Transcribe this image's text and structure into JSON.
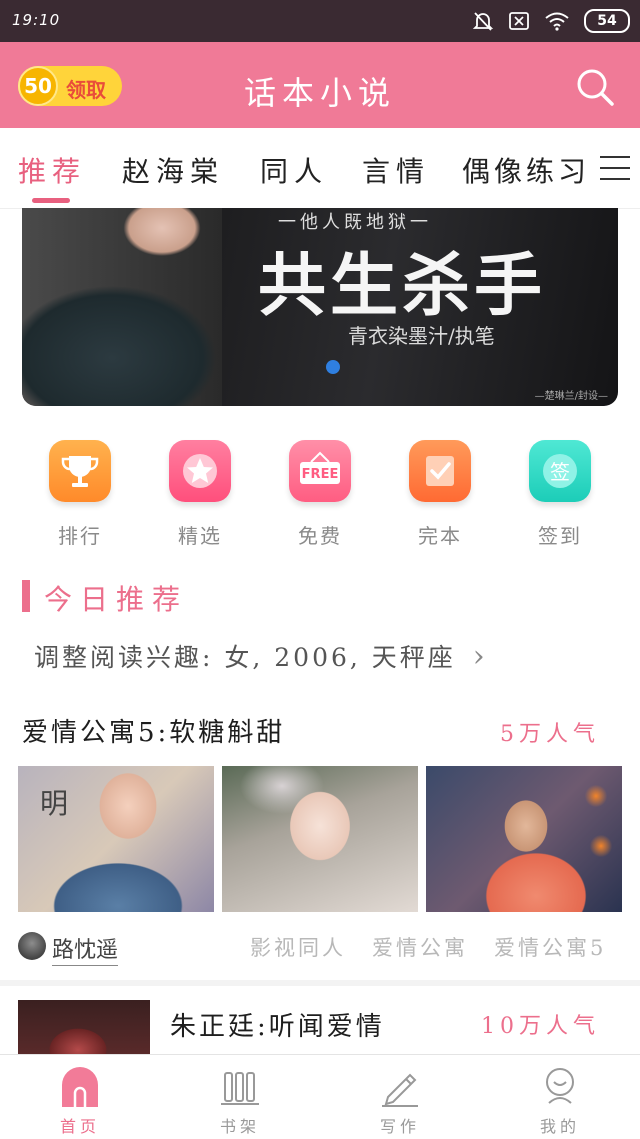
{
  "status_bar": {
    "time": "19:10",
    "battery": "54",
    "icons": [
      "mute-bell-icon",
      "close-box-icon",
      "wifi-icon",
      "battery-icon"
    ]
  },
  "header": {
    "coin_count": "50",
    "coin_label": "领取",
    "title": "话本小说",
    "search_icon": "search-icon",
    "bg_color": "#f07a97"
  },
  "tabs": [
    {
      "label": "推荐",
      "active": true
    },
    {
      "label": "赵海棠",
      "active": false
    },
    {
      "label": "同人",
      "active": false
    },
    {
      "label": "言情",
      "active": false
    },
    {
      "label": "偶像练习",
      "active": false
    }
  ],
  "banner": {
    "subtitle": "一他人既地狱一",
    "title": "共生杀手",
    "author": "青衣染墨汁/执笔",
    "credit": "—楚琳兰/封设—"
  },
  "quick_links": [
    {
      "label": "排行",
      "icon": "trophy-icon",
      "color": "#ff9a3c"
    },
    {
      "label": "精选",
      "icon": "star-icon",
      "color": "#ff5f8a"
    },
    {
      "label": "免费",
      "icon": "free-tag-icon",
      "color": "#ff6b8d"
    },
    {
      "label": "完本",
      "icon": "checkbox-icon",
      "color": "#ff7b45"
    },
    {
      "label": "签到",
      "icon": "sign-in-icon",
      "color": "#2ed9c4"
    }
  ],
  "today": {
    "title": "今日推荐",
    "interest_text": "调整阅读兴趣: 女, 2006, 天秤座",
    "chevron": "›"
  },
  "books": [
    {
      "title": "爱情公寓5:软糖斛甜",
      "popularity": "5万人气",
      "thumb_text": "明",
      "author": "路忱遥",
      "tags": [
        "影视同人",
        "爱情公寓",
        "爱情公寓5"
      ]
    },
    {
      "title": "朱正廷:听闻爱情",
      "popularity": "10万人气"
    }
  ],
  "bottom_nav": [
    {
      "label": "首页",
      "icon": "home-icon",
      "active": true
    },
    {
      "label": "书架",
      "icon": "bookshelf-icon",
      "active": false
    },
    {
      "label": "写作",
      "icon": "pencil-icon",
      "active": false
    },
    {
      "label": "我的",
      "icon": "profile-icon",
      "active": false
    }
  ],
  "accent_color": "#ec6f8c"
}
